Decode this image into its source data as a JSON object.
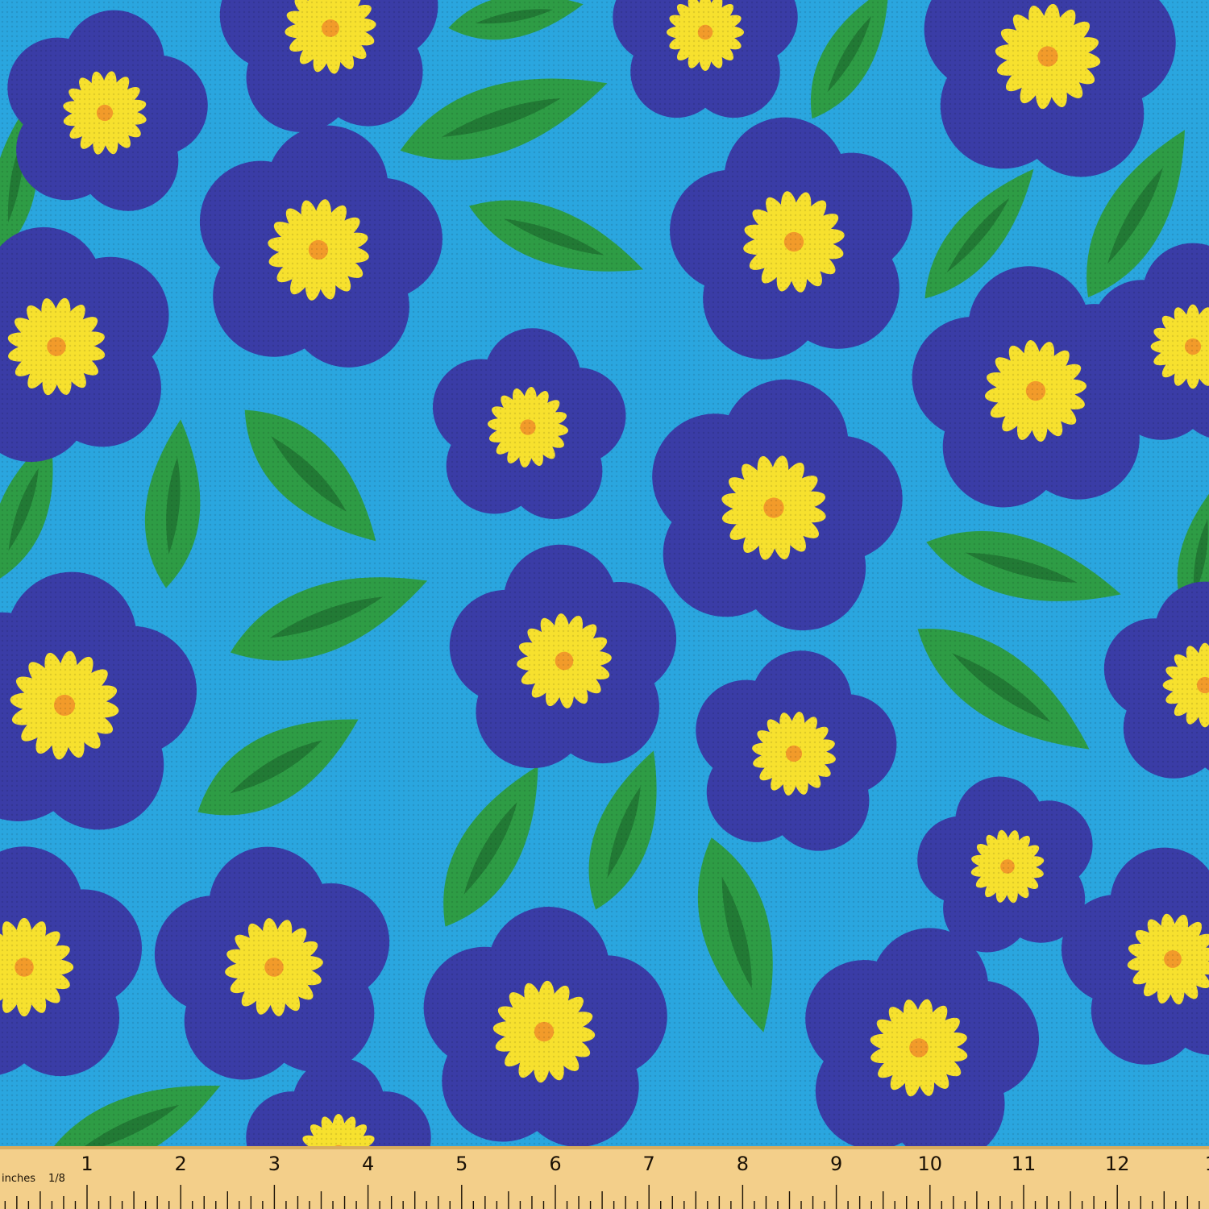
{
  "fabric": {
    "colors": {
      "background": "#2aa6df",
      "petal": "#3a3ca6",
      "center_yellow": "#f7e12e",
      "center_orange": "#f29b2a",
      "leaf": "#2e9c45",
      "leaf_vein": "#227a35"
    }
  },
  "ruler": {
    "unit_label": "inches",
    "fraction_label": "1/8",
    "numbers": [
      "1",
      "2",
      "3",
      "4",
      "5",
      "6",
      "7",
      "8",
      "9",
      "10",
      "11",
      "12",
      "1"
    ],
    "colors": {
      "wood": "#f3cf8a",
      "edge": "#d8ac5e",
      "ink": "#1b1206"
    }
  }
}
